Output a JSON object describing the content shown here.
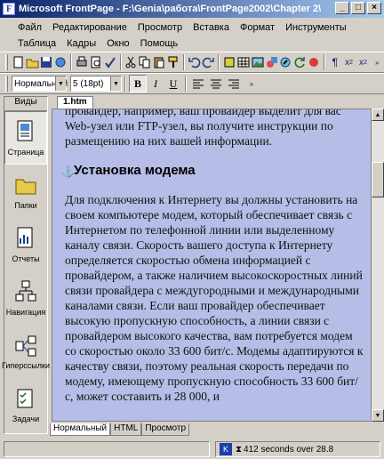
{
  "window": {
    "title": "Microsoft FrontPage - F:\\Genia\\работа\\FrontPage2002\\Chapter 2\\1...",
    "app_icon_letter": "F",
    "minimize": "_",
    "maximize": "□",
    "close": "×"
  },
  "menu": {
    "row1": [
      "Файл",
      "Редактирование",
      "Просмотр",
      "Вставка",
      "Формат",
      "Инструменты"
    ],
    "row2": [
      "Таблица",
      "Кадры",
      "Окно",
      "Помощь"
    ]
  },
  "toolbar_format": {
    "style": "Нормальный",
    "font_size": "5 (18pt)",
    "bold": "B",
    "italic": "I",
    "underline": "U"
  },
  "views": {
    "header": "Виды",
    "items": [
      {
        "label": "Страница",
        "icon": "page-view-icon"
      },
      {
        "label": "Папки",
        "icon": "folders-view-icon"
      },
      {
        "label": "Отчеты",
        "icon": "reports-view-icon"
      },
      {
        "label": "Навигация",
        "icon": "navigation-view-icon"
      },
      {
        "label": "Гиперссылки",
        "icon": "hyperlinks-view-icon"
      },
      {
        "label": "Задачи",
        "icon": "tasks-view-icon"
      }
    ]
  },
  "document": {
    "tab": "1.htm",
    "intro": "провайдер, например, ваш провайдер выделит для вас Web-узел или FTP-узел, вы получите инструкции по размещению на них вашей информации.",
    "heading": "Установка модема",
    "body": "Для подключения к Интернету вы должны установить на своем компьютере модем, который обеспечивает связь с Интернетом по телефонной линии или выделенному каналу связи. Скорость вашего доступа к Интернету определяется скоростью обмена информацией с провайдером, а также наличием высокоскоростных линий связи провайдера с междугородными и международными каналами связи. Если ваш провайдер обеспечивает высокую пропускную способность, а линии связи с провайдером высокого качества, вам потребуется модем со скоростью около 33 600 бит/с. Модемы адаптируются к качеству связи, поэтому реальная скорость передачи по модему, имеющему пропускную способность 33 600 бит/с, может составить и 28 000, и"
  },
  "view_tabs": [
    "Нормальный",
    "HTML",
    "Просмотр"
  ],
  "status": {
    "text": "412 seconds over 28.8"
  }
}
